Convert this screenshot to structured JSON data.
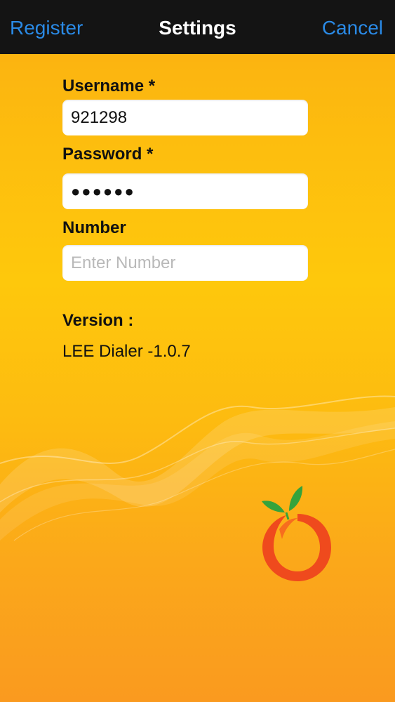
{
  "navbar": {
    "left_label": "Register",
    "title": "Settings",
    "right_label": "Cancel"
  },
  "form": {
    "username": {
      "label": "Username *",
      "value": "921298"
    },
    "password": {
      "label": "Password *",
      "value": "●●●●●●"
    },
    "number": {
      "label": "Number",
      "value": "",
      "placeholder": "Enter Number"
    }
  },
  "version": {
    "label": "Version :",
    "value": "LEE Dialer -1.0.7"
  },
  "colors": {
    "navbar_background": "#141414",
    "nav_button": "#2a8ae6",
    "background_top": "#fbae12",
    "background_bottom": "#fa9a1f",
    "logo_orange": "#ef4a1d",
    "logo_leaf": "#35a33c"
  },
  "icons": {
    "logo": "orange-fruit-logo-icon"
  }
}
